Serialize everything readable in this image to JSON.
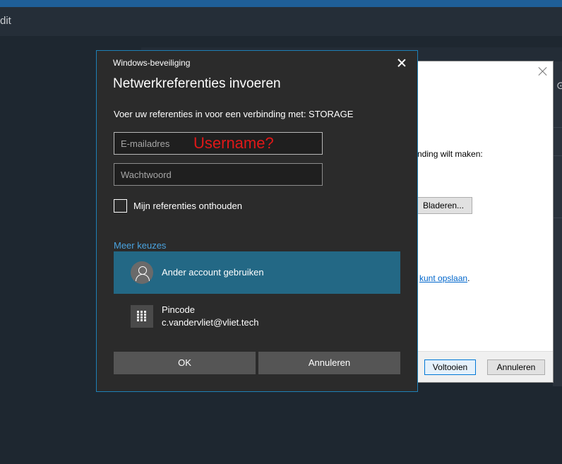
{
  "background_app": {
    "menu_text": "dit",
    "right_glyph": "⊙"
  },
  "wizard": {
    "text1": "nding wilt maken:",
    "browse_label": "Bladeren...",
    "link_text": "kunt opslaan",
    "link_suffix": ".",
    "finish_label": "Voltooien",
    "cancel_label": "Annuleren"
  },
  "credential_dialog": {
    "app_name": "Windows-beveiliging",
    "title": "Netwerkreferenties invoeren",
    "description": "Voer uw referenties in voor een verbinding met: STORAGE",
    "email_placeholder": "E-mailadres",
    "email_value": "",
    "annotation": "Username?",
    "password_placeholder": "Wachtwoord",
    "password_value": "",
    "remember_label": "Mijn referenties onthouden",
    "remember_checked": false,
    "more_choices": "Meer keuzes",
    "options": [
      {
        "label": "Ander account gebruiken",
        "icon": "user-icon",
        "selected": true
      },
      {
        "label": "Pincode",
        "sublabel": "c.vandervliet@vliet.tech",
        "icon": "keypad-icon",
        "selected": false
      }
    ],
    "ok_label": "OK",
    "cancel_label": "Annuleren",
    "colors": {
      "accent_border": "#1e80b6",
      "selected_option": "#236885",
      "link": "#4aa3df",
      "annotation": "#e01818"
    }
  }
}
